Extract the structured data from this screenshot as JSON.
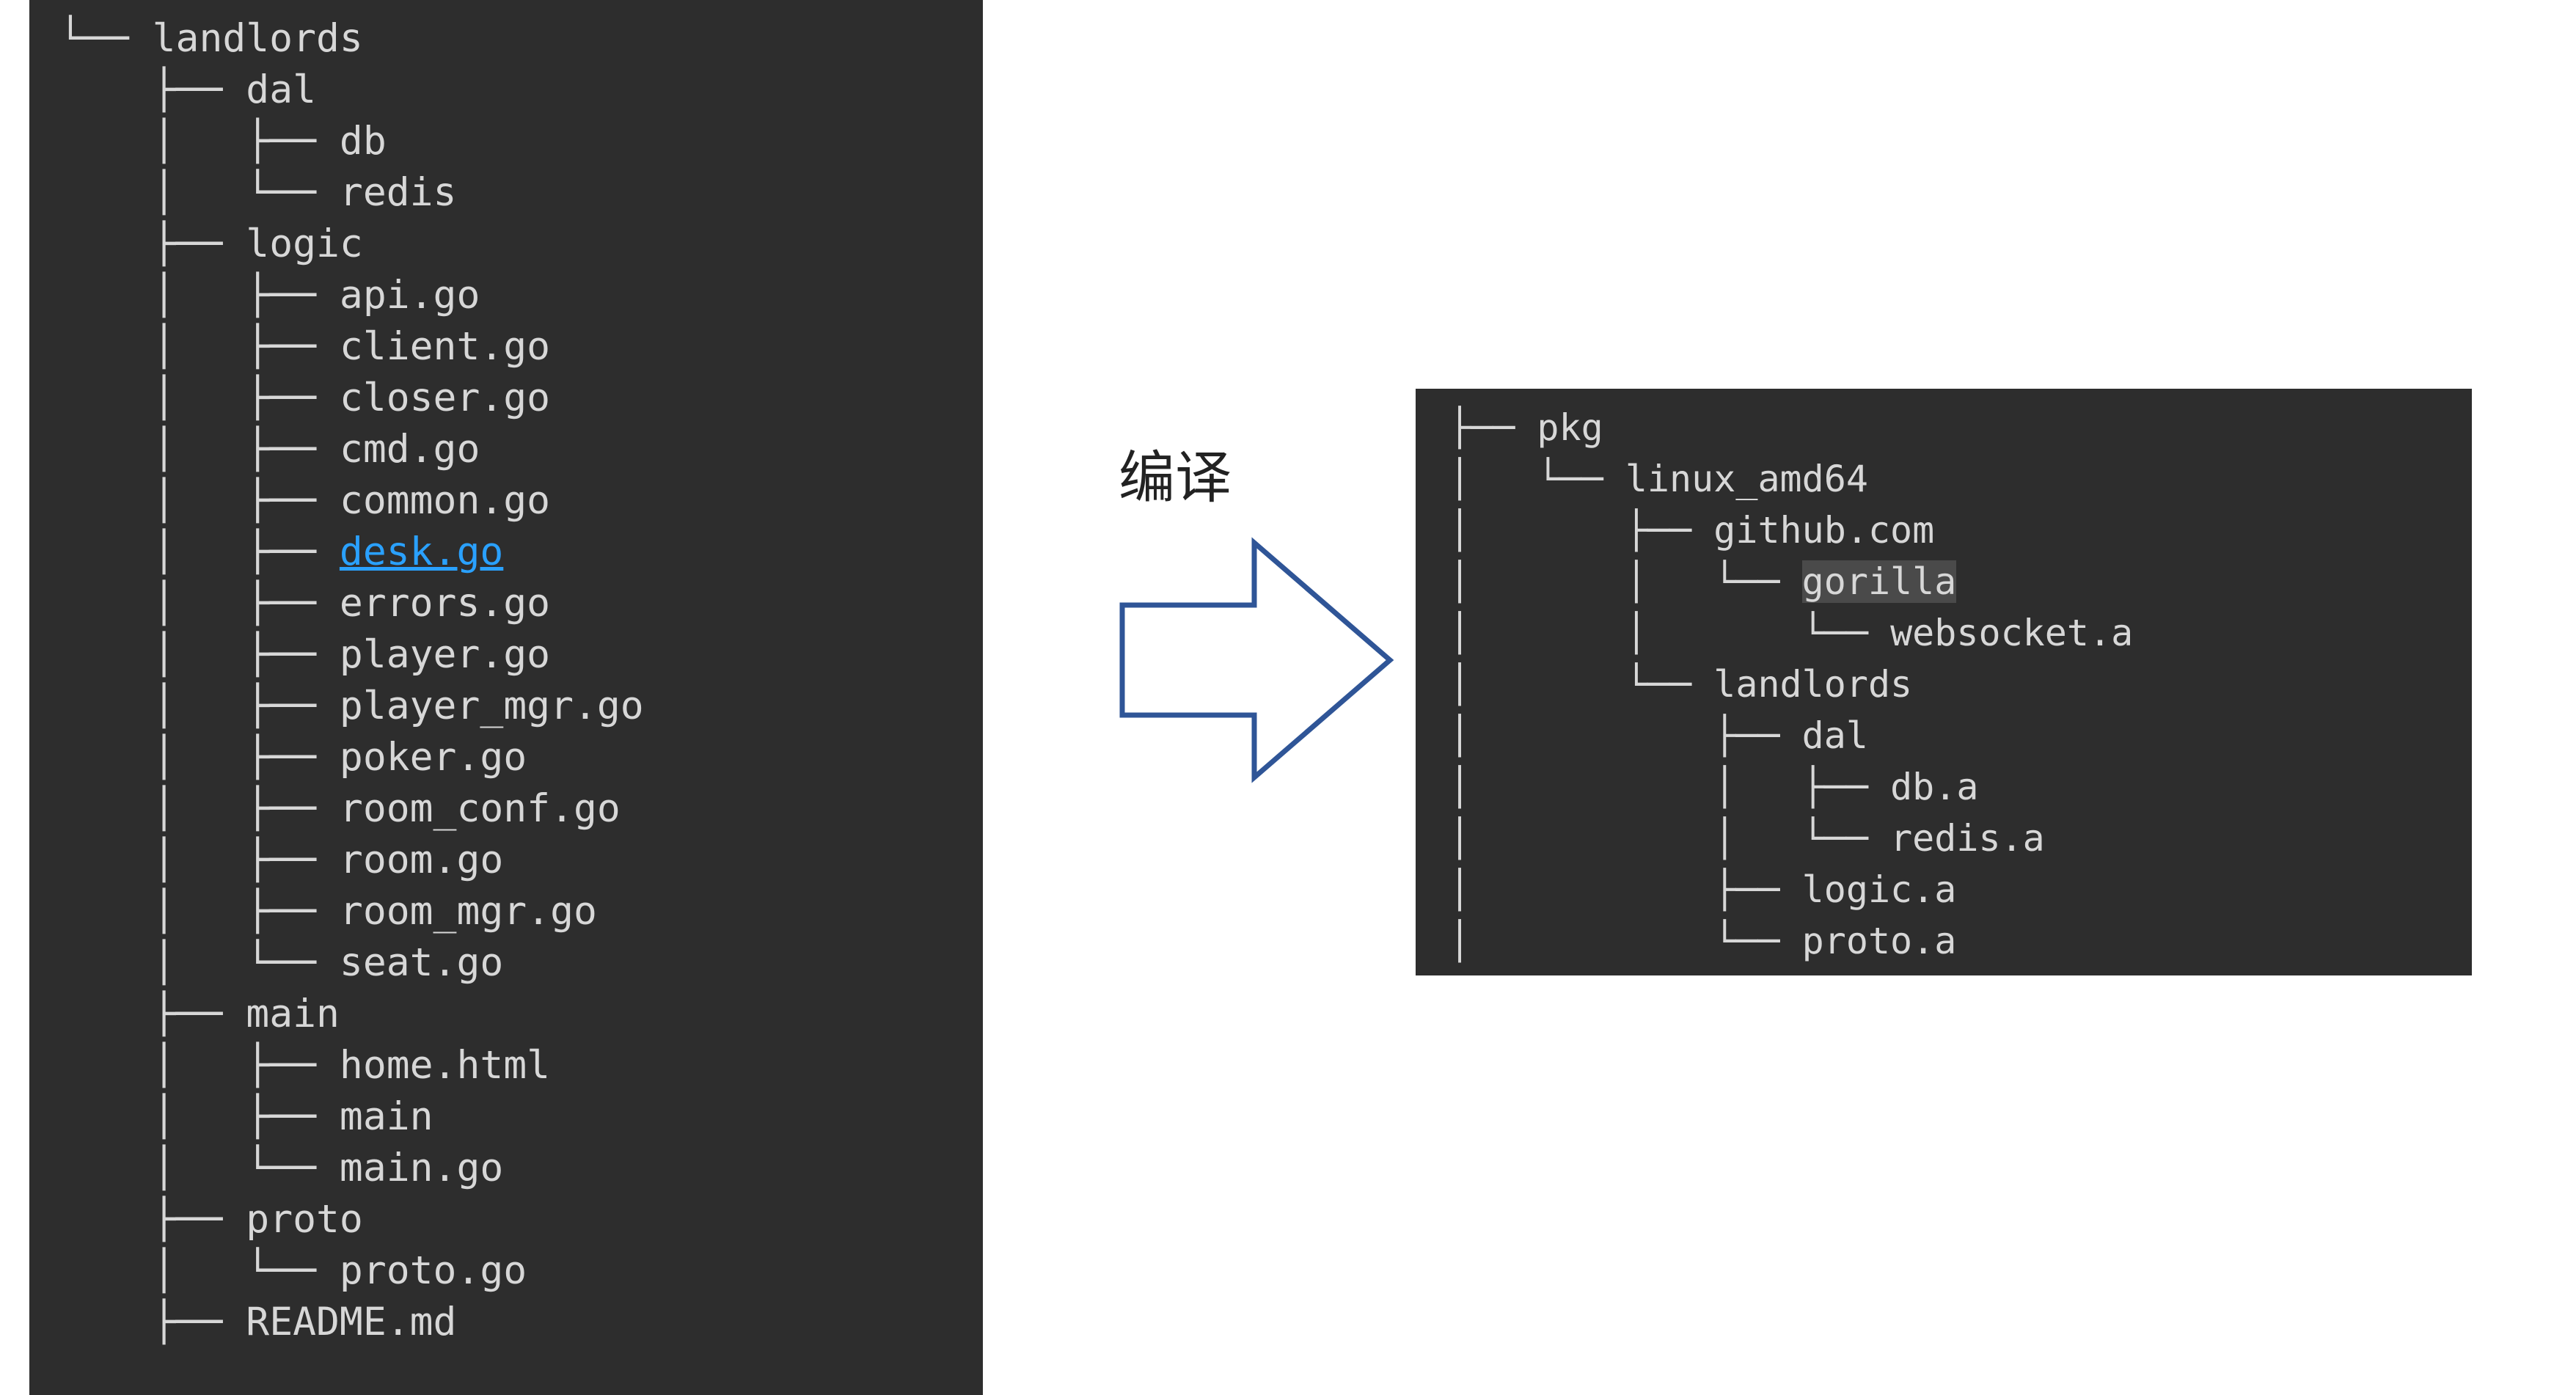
{
  "left_tree": {
    "lines": [
      {
        "prefix": "└── ",
        "name": "landlords",
        "style": ""
      },
      {
        "prefix": "    ├── ",
        "name": "dal",
        "style": ""
      },
      {
        "prefix": "    │   ├── ",
        "name": "db",
        "style": ""
      },
      {
        "prefix": "    │   └── ",
        "name": "redis",
        "style": ""
      },
      {
        "prefix": "    ├── ",
        "name": "logic",
        "style": ""
      },
      {
        "prefix": "    │   ├── ",
        "name": "api.go",
        "style": ""
      },
      {
        "prefix": "    │   ├── ",
        "name": "client.go",
        "style": ""
      },
      {
        "prefix": "    │   ├── ",
        "name": "closer.go",
        "style": ""
      },
      {
        "prefix": "    │   ├── ",
        "name": "cmd.go",
        "style": ""
      },
      {
        "prefix": "    │   ├── ",
        "name": "common.go",
        "style": ""
      },
      {
        "prefix": "    │   ├── ",
        "name": "desk.go",
        "style": "hlink"
      },
      {
        "prefix": "    │   ├── ",
        "name": "errors.go",
        "style": ""
      },
      {
        "prefix": "    │   ├── ",
        "name": "player.go",
        "style": ""
      },
      {
        "prefix": "    │   ├── ",
        "name": "player_mgr.go",
        "style": ""
      },
      {
        "prefix": "    │   ├── ",
        "name": "poker.go",
        "style": ""
      },
      {
        "prefix": "    │   ├── ",
        "name": "room_conf.go",
        "style": ""
      },
      {
        "prefix": "    │   ├── ",
        "name": "room.go",
        "style": ""
      },
      {
        "prefix": "    │   ├── ",
        "name": "room_mgr.go",
        "style": ""
      },
      {
        "prefix": "    │   └── ",
        "name": "seat.go",
        "style": ""
      },
      {
        "prefix": "    ├── ",
        "name": "main",
        "style": ""
      },
      {
        "prefix": "    │   ├── ",
        "name": "home.html",
        "style": ""
      },
      {
        "prefix": "    │   ├── ",
        "name": "main",
        "style": ""
      },
      {
        "prefix": "    │   └── ",
        "name": "main.go",
        "style": ""
      },
      {
        "prefix": "    ├── ",
        "name": "proto",
        "style": ""
      },
      {
        "prefix": "    │   └── ",
        "name": "proto.go",
        "style": ""
      },
      {
        "prefix": "    ├── ",
        "name": "README.md",
        "style": ""
      }
    ]
  },
  "right_tree": {
    "lines": [
      {
        "prefix": "├── ",
        "name": "pkg",
        "style": ""
      },
      {
        "prefix": "│   └── ",
        "name": "linux_amd64",
        "style": ""
      },
      {
        "prefix": "│       ├── ",
        "name": "github.com",
        "style": ""
      },
      {
        "prefix": "│       │   └── ",
        "name": "gorilla",
        "style": "highlight"
      },
      {
        "prefix": "│       │       └── ",
        "name": "websocket.a",
        "style": ""
      },
      {
        "prefix": "│       └── ",
        "name": "landlords",
        "style": ""
      },
      {
        "prefix": "│           ├── ",
        "name": "dal",
        "style": ""
      },
      {
        "prefix": "│           │   ├── ",
        "name": "db.a",
        "style": ""
      },
      {
        "prefix": "│           │   └── ",
        "name": "redis.a",
        "style": ""
      },
      {
        "prefix": "│           ├── ",
        "name": "logic.a",
        "style": ""
      },
      {
        "prefix": "│           └── ",
        "name": "proto.a",
        "style": ""
      }
    ]
  },
  "arrow_label": "编译"
}
